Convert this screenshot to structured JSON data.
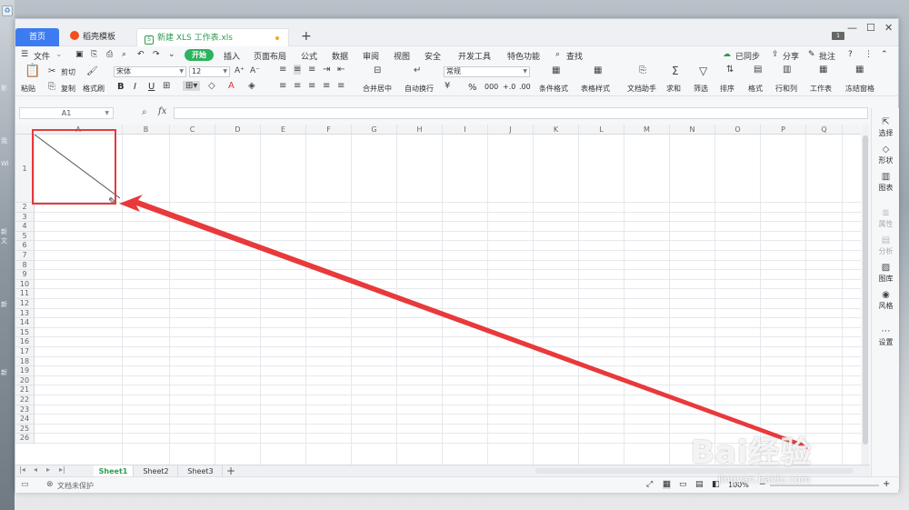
{
  "desktop": {
    "snippets": [
      "影",
      "我",
      "Wi",
      "新",
      "文",
      "新",
      "新"
    ]
  },
  "tabs": {
    "home": "首页",
    "template": "稻壳模板",
    "document": "新建 XLS 工作表.xls",
    "add": "+"
  },
  "window_controls": {
    "badge": "1",
    "minimize": "—",
    "maximize": "☐",
    "close": "✕"
  },
  "menu": {
    "file": "文件",
    "start": "开始",
    "items": [
      "插入",
      "页面布局",
      "公式",
      "数据",
      "审阅",
      "视图",
      "安全",
      "开发工具",
      "特色功能"
    ],
    "search": "查找",
    "sync": "已同步",
    "share": "分享",
    "comment": "批注"
  },
  "ribbon": {
    "paste": "粘贴",
    "cut": "剪切",
    "copy": "复制",
    "format_painter": "格式刷",
    "font_name": "宋体",
    "font_size": "12",
    "bold": "B",
    "italic": "I",
    "underline": "U",
    "merge_center": "合并居中",
    "wrap_text": "自动换行",
    "number_format": "常规",
    "percent": "%",
    "thousands": "000",
    "decimal_inc": "+.0",
    "decimal_dec": ".00",
    "conditional_format": "条件格式",
    "table_style": "表格样式",
    "doc_helper": "文档助手",
    "sum": "求和",
    "filter": "筛选",
    "sort": "排序",
    "format": "格式",
    "row_col": "行和列",
    "worksheet": "工作表",
    "freeze": "冻结窗格"
  },
  "formula_bar": {
    "cell_ref": "A1",
    "fx": "fx",
    "value": ""
  },
  "grid": {
    "columns": [
      "A",
      "B",
      "C",
      "D",
      "E",
      "F",
      "G",
      "H",
      "I",
      "J",
      "K",
      "L",
      "M",
      "N",
      "O",
      "P",
      "Q"
    ],
    "rows": [
      "1",
      "2",
      "3",
      "4",
      "5",
      "6",
      "7",
      "8",
      "9",
      "10",
      "11",
      "12",
      "13",
      "14",
      "15",
      "16",
      "17",
      "18",
      "19",
      "20",
      "21",
      "22",
      "23",
      "24",
      "25",
      "26"
    ]
  },
  "right_panel": [
    {
      "label": "选择",
      "icon": "cursor-icon",
      "enabled": true
    },
    {
      "label": "形状",
      "icon": "shape-icon",
      "enabled": true
    },
    {
      "label": "图表",
      "icon": "chart-icon",
      "enabled": true
    },
    {
      "label": "属性",
      "icon": "properties-icon",
      "enabled": false
    },
    {
      "label": "分析",
      "icon": "analysis-icon",
      "enabled": false
    },
    {
      "label": "图库",
      "icon": "gallery-icon",
      "enabled": true
    },
    {
      "label": "风格",
      "icon": "style-icon",
      "enabled": true
    },
    {
      "label": "设置",
      "icon": "more-icon",
      "enabled": true
    }
  ],
  "sheets": [
    "Sheet1",
    "Sheet2",
    "Sheet3"
  ],
  "active_sheet": "Sheet1",
  "status": {
    "protect": "文档未保护",
    "zoom": "100%"
  },
  "watermark": {
    "logo": "Bai经验",
    "url": "jingyan.baidu.com"
  },
  "colors": {
    "accent_green": "#2db35d",
    "tab_blue": "#3d7bf0",
    "annotation_red": "#e8393b"
  }
}
